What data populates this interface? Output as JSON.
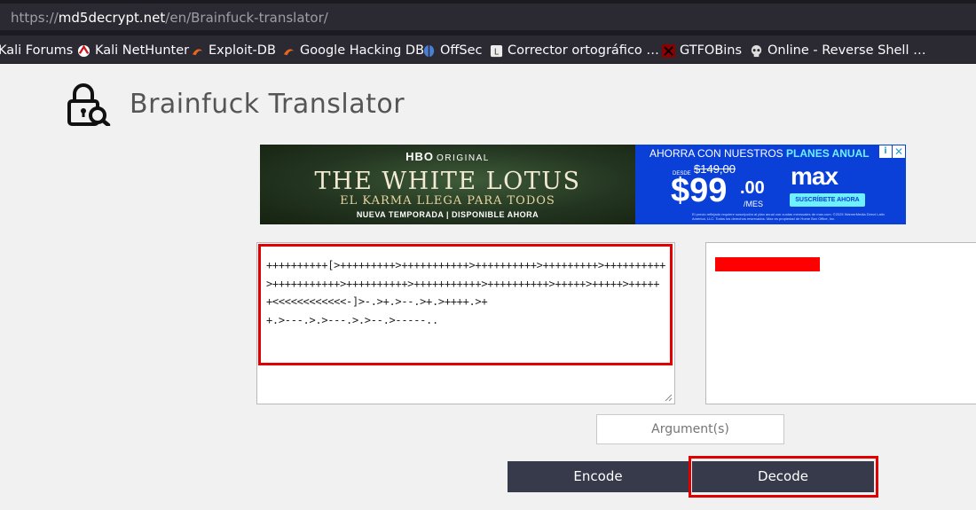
{
  "browser": {
    "url_prefix": "https://",
    "url_host": "md5decrypt.net",
    "url_path": "/en/Brainfuck-translator/",
    "bookmarks": [
      {
        "label": "Kali Forums",
        "icon": "kali-icon"
      },
      {
        "label": "Kali NetHunter",
        "icon": "kali-nethunter-icon"
      },
      {
        "label": "Exploit-DB",
        "icon": "exploit-db-icon"
      },
      {
        "label": "Google Hacking DB",
        "icon": "ghdb-icon"
      },
      {
        "label": "OffSec",
        "icon": "offsec-icon"
      },
      {
        "label": "Corrector ortográfico …",
        "icon": "spellcheck-icon"
      },
      {
        "label": "GTFOBins",
        "icon": "gtfobins-icon"
      },
      {
        "label": "Online - Reverse Shell …",
        "icon": "skull-icon"
      }
    ]
  },
  "page": {
    "title": "Brainfuck Translator"
  },
  "ad": {
    "hbo": "HBO",
    "original": "ORIGINAL",
    "show": "THE WHITE LOTUS",
    "tagline": "EL KARMA LLEGA PARA TODOS",
    "subline": "NUEVA TEMPORADA | DISPONIBLE AHORA",
    "promo_prefix": "AHORRA CON NUESTROS ",
    "promo_highlight": "PLANES ANUAL",
    "desde": "DESDE",
    "old_price": "$149,00",
    "price": "$99",
    "cents": ".00",
    "per": "/MES",
    "brand": "max",
    "cta": "SUSCRÍBETE AHORA",
    "fine_print": "El precio reflejado requiere suscripción al plan anual con cuotas mensuales de max.com. ©2025 WarnerMedia Direct Latin America, LLC. Todos los derechos reservados. Max es propiedad de Home Box Office, Inc.",
    "info": "i",
    "close": "✕"
  },
  "translator": {
    "input_value": "++++++++++[>+++++++++>+++++++++++>++++++++++>+++++++++>++++++++++>+++++++++++>++++++++++>+++++++++++>++++++++++>+++++>+++++>+++++\n+<<<<<<<<<<<<-]>-.>+.>--.>+.>++++.>+\n+.>---.>.>---.>.>--.>-----..",
    "argument_placeholder": "Argument(s)",
    "encode_label": "Encode",
    "decode_label": "Decode"
  },
  "colors": {
    "annotation_red": "#e00000",
    "button_bg": "#363a4a",
    "ad_blue": "#0a3fd8"
  }
}
